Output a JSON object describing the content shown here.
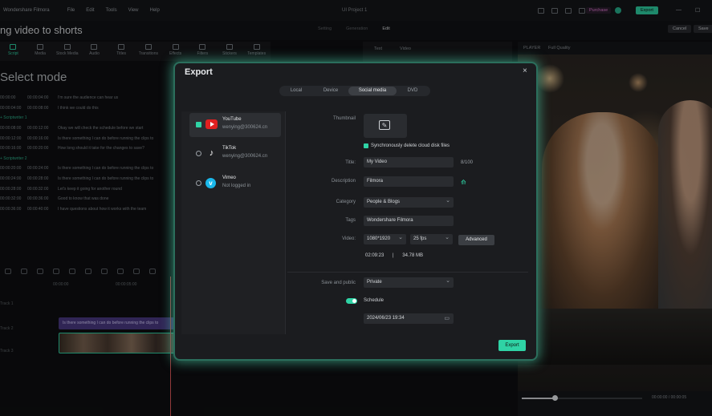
{
  "topbar": {
    "app_name": "Wondershare Filmora",
    "menu": [
      "File",
      "Edit",
      "Tools",
      "View",
      "Help"
    ],
    "project": "UI Project 1",
    "purchase_label": "Purchase",
    "export_label": "Export",
    "window_controls": [
      "—",
      "☐"
    ]
  },
  "header": {
    "title": "ng video to shorts",
    "steps": [
      "Setting",
      "Generation",
      "Edit"
    ],
    "cancel_label": "Cancel",
    "save_label": "Save"
  },
  "toolbar": {
    "items": [
      {
        "label": "Script",
        "icon": "script-icon"
      },
      {
        "label": "Media",
        "icon": "media-icon"
      },
      {
        "label": "Stock Media",
        "icon": "stock-media-icon"
      },
      {
        "label": "Audio",
        "icon": "audio-icon"
      },
      {
        "label": "Titles",
        "icon": "titles-icon"
      },
      {
        "label": "Transitions",
        "icon": "transitions-icon"
      },
      {
        "label": "Effects",
        "icon": "effects-icon"
      },
      {
        "label": "Filters",
        "icon": "filters-icon"
      },
      {
        "label": "Stickers",
        "icon": "stickers-icon"
      },
      {
        "label": "Templates",
        "icon": "templates-icon"
      }
    ]
  },
  "left": {
    "mode_title": "Select mode",
    "script_rows": [
      {
        "start": "00:00:00",
        "end": "00:00:04:00",
        "text": "I'm sure the audience can hear us"
      },
      {
        "start": "00:00:04:00",
        "end": "00:00:08:00",
        "text": "I think we could do this"
      },
      {
        "start": "",
        "end": "",
        "text": "+ Scriptwriter 1",
        "hl": true
      },
      {
        "start": "00:00:08:00",
        "end": "00:00:12:00",
        "text": "Okay we will check the schedule before we start"
      },
      {
        "start": "00:00:12:00",
        "end": "00:00:16:00",
        "text": "Is there something I can do before running the clips to"
      },
      {
        "start": "00:00:16:00",
        "end": "00:00:20:00",
        "text": "How long should it take for the changes to save?"
      },
      {
        "start": "",
        "end": "",
        "text": "+ Scriptwriter 2",
        "hl": true
      },
      {
        "start": "00:00:20:00",
        "end": "00:00:24:00",
        "text": "Is there something I can do before running the clips to"
      },
      {
        "start": "00:00:24:00",
        "end": "00:00:28:00",
        "text": "Is there something I can do before running the clips to"
      },
      {
        "start": "00:00:28:00",
        "end": "00:00:32:00",
        "text": "Let's keep it going for another round"
      },
      {
        "start": "00:00:32:00",
        "end": "00:00:36:00",
        "text": "Good to know that was done"
      },
      {
        "start": "00:00:36:00",
        "end": "00:00:40:00",
        "text": "I have questions about how it works with the team"
      }
    ]
  },
  "timeline": {
    "ruler": [
      "00:00:00",
      "00:00:05:00"
    ],
    "caption_text": "Is there something I can do before running the clips to",
    "tracks": [
      "Track 1",
      "Track 2",
      "Track 3"
    ]
  },
  "middle": {
    "tabs": [
      "Text",
      "Video"
    ]
  },
  "player": {
    "label": "PLAYER",
    "quality": "Full Quality",
    "time": "00:00:00 / 00:00:05"
  },
  "dialog": {
    "title": "Export",
    "close": "×",
    "tabs": [
      "Local",
      "Device",
      "Social media",
      "DVD"
    ],
    "selected_tab": "Social media",
    "platforms": [
      {
        "name": "YouTube",
        "account": "wenying@300624.cn",
        "selected": true
      },
      {
        "name": "TikTok",
        "account": "wenying@300624.cn",
        "selected": false
      },
      {
        "name": "Vimeo",
        "account": "Not logged in",
        "selected": false
      }
    ],
    "labels": {
      "thumbnail": "Thumbnail",
      "title": "Title:",
      "description": "Description",
      "category": "Category",
      "tags": "Tags",
      "video": "Video:",
      "save_public": "Save and public"
    },
    "sync_label": "Synchronously delete cloud disk files",
    "title_value": "My Video",
    "title_counter": "8/100",
    "description_value": "Filmora",
    "category_value": "People & Blogs",
    "tags_value": "Wondershare Filmora",
    "resolution": "1080*1920",
    "fps": "25 fps",
    "advanced_label": "Advanced",
    "duration": "02:09:23",
    "separator": "|",
    "size": "34.78 MB",
    "privacy": "Private",
    "schedule_label": "Schedule",
    "schedule_value": "2024/06/23  19:34",
    "export_label": "Export"
  }
}
